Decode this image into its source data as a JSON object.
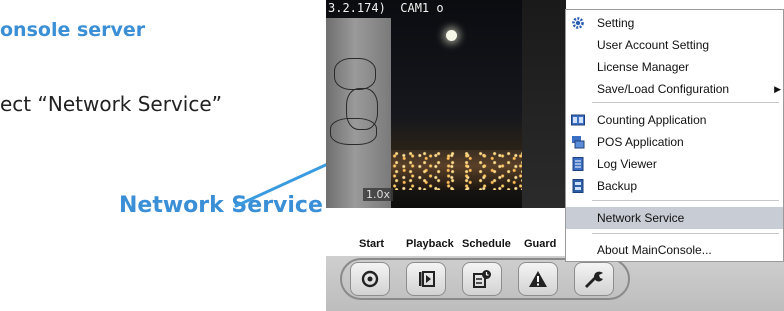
{
  "instructions": {
    "heading": "onsole server",
    "step_text": "ect “Network Service”",
    "callout_label": "Network Service"
  },
  "camera": {
    "header": "3.2.174)  CAM1 o",
    "zoom": "1.0x"
  },
  "toolbar": {
    "labels": [
      "Start",
      "Playback",
      "Schedule",
      "Guard"
    ],
    "buttons": [
      {
        "name": "start",
        "icon": "record-icon"
      },
      {
        "name": "playback",
        "icon": "play-icon"
      },
      {
        "name": "schedule",
        "icon": "schedule-icon"
      },
      {
        "name": "guard",
        "icon": "warning-icon"
      },
      {
        "name": "tools",
        "icon": "wrench-icon"
      }
    ]
  },
  "menu": {
    "items": [
      {
        "label": "Setting",
        "icon": "gear-icon",
        "highlight": false
      },
      {
        "label": "User Account Setting",
        "icon": "",
        "highlight": false
      },
      {
        "label": "License Manager",
        "icon": "",
        "highlight": false
      },
      {
        "label": "Save/Load Configuration",
        "icon": "",
        "highlight": false,
        "submenu": true
      },
      {
        "label": "Counting Application",
        "icon": "counting-icon",
        "highlight": false
      },
      {
        "label": "POS Application",
        "icon": "pos-icon",
        "highlight": false
      },
      {
        "label": "Log Viewer",
        "icon": "log-icon",
        "highlight": false
      },
      {
        "label": "Backup",
        "icon": "backup-icon",
        "highlight": false
      },
      {
        "label": "Network Service",
        "icon": "",
        "highlight": true
      },
      {
        "label": "About MainConsole...",
        "icon": "",
        "highlight": false
      }
    ]
  },
  "colors": {
    "accent": "#3a8fd6",
    "menu_highlight": "#c8ccd4"
  }
}
